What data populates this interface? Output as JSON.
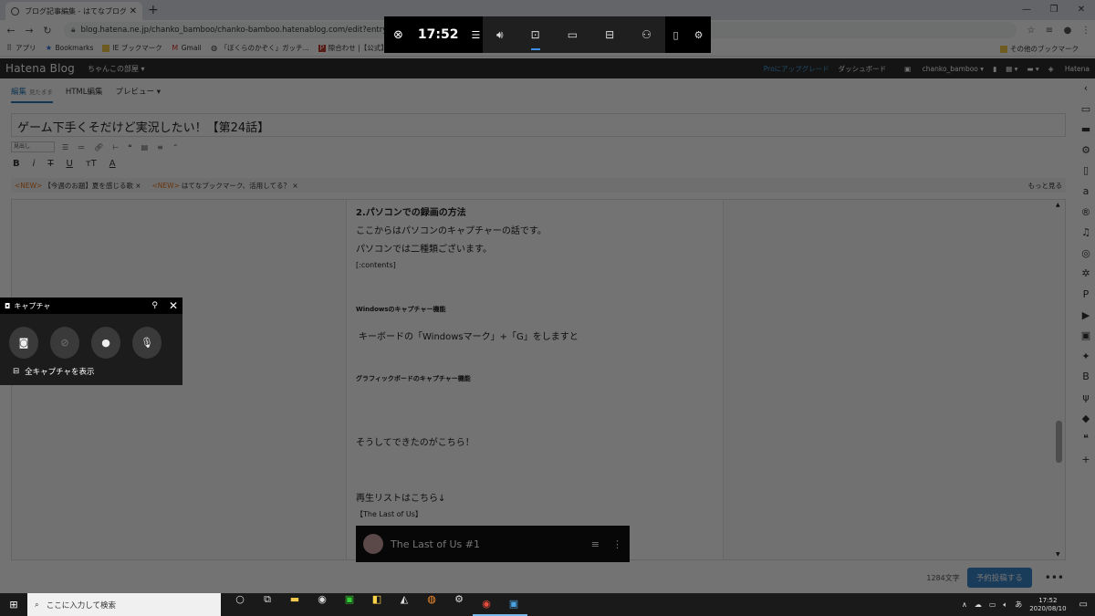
{
  "browser": {
    "tab_title": "ブログ記事編集 - はてなブログ",
    "tab_close": "✕",
    "new_tab": "+",
    "url": "blog.hatena.ne.jp/chanko_bamboo/chanko-bamboo.hatenablog.com/edit?entry=2600",
    "window_controls": [
      "—",
      "❐",
      "✕"
    ]
  },
  "bookmarks": {
    "items": [
      {
        "icon": "apps-icon",
        "label": "アプリ"
      },
      {
        "icon": "star-icon",
        "label": "Bookmarks"
      },
      {
        "icon": "folder-icon",
        "label": "IE ブックマーク"
      },
      {
        "icon": "gmail-icon",
        "label": "Gmail"
      },
      {
        "icon": "site-icon",
        "label": "「ぼくらのかぞく」ガッチ..."
      },
      {
        "icon": "site-icon",
        "label": "隙合わせ |【公式】..."
      }
    ],
    "other": "その他のブックマーク"
  },
  "hatena": {
    "logo": "Hatena Blog",
    "blog_name": "ちゃんこの部屋",
    "pro": "Proにアップグレード",
    "dashboard": "ダッシュボード",
    "user": "chanko_bamboo",
    "brand": "Hatena"
  },
  "editor": {
    "tabs": [
      {
        "label": "編集",
        "sub": "見たまま",
        "active": true
      },
      {
        "label": "HTML編集",
        "sub": "",
        "active": false
      },
      {
        "label": "プレビュー",
        "sub": "",
        "active": false
      }
    ],
    "title": "ゲーム下手くそだけど実況したい！【第24話】",
    "heading_select": "見出し",
    "notices": [
      {
        "tag": "<NEW>",
        "text": "【今週のお題】夏を感じる歌 ×"
      },
      {
        "tag": "<NEW>",
        "text": "はてなブックマーク、活用してる？ ×"
      }
    ],
    "more": "もっと見る",
    "content": {
      "h": "2.パソコンでの録画の方法",
      "p1": "ここからはパソコンのキャプチャーの話です。",
      "p2": "パソコンでは二種類ございます。",
      "p3": "[:contents]",
      "h2": "Windowsのキャプチャー機能",
      "p4": "キーボードの「Windowsマーク」+「G」をしますと",
      "h3": "グラフィックボードのキャプチャー機能",
      "p5": "そうしてできたのがこちら！",
      "p6": "再生リストはこちら↓",
      "p7": "【The Last of Us】",
      "video_title": "The Last of Us #1"
    },
    "char_count": "1284文字",
    "schedule_button": "予約投稿する",
    "more_dots": "•••"
  },
  "gamebar": {
    "time": "17:52"
  },
  "capture": {
    "title": "キャプチャ",
    "show_all": "全キャプチャを表示"
  },
  "taskbar": {
    "search_placeholder": "ここに入力して検索",
    "clock_time": "17:52",
    "clock_date": "2020/08/10",
    "ime": "あ"
  }
}
